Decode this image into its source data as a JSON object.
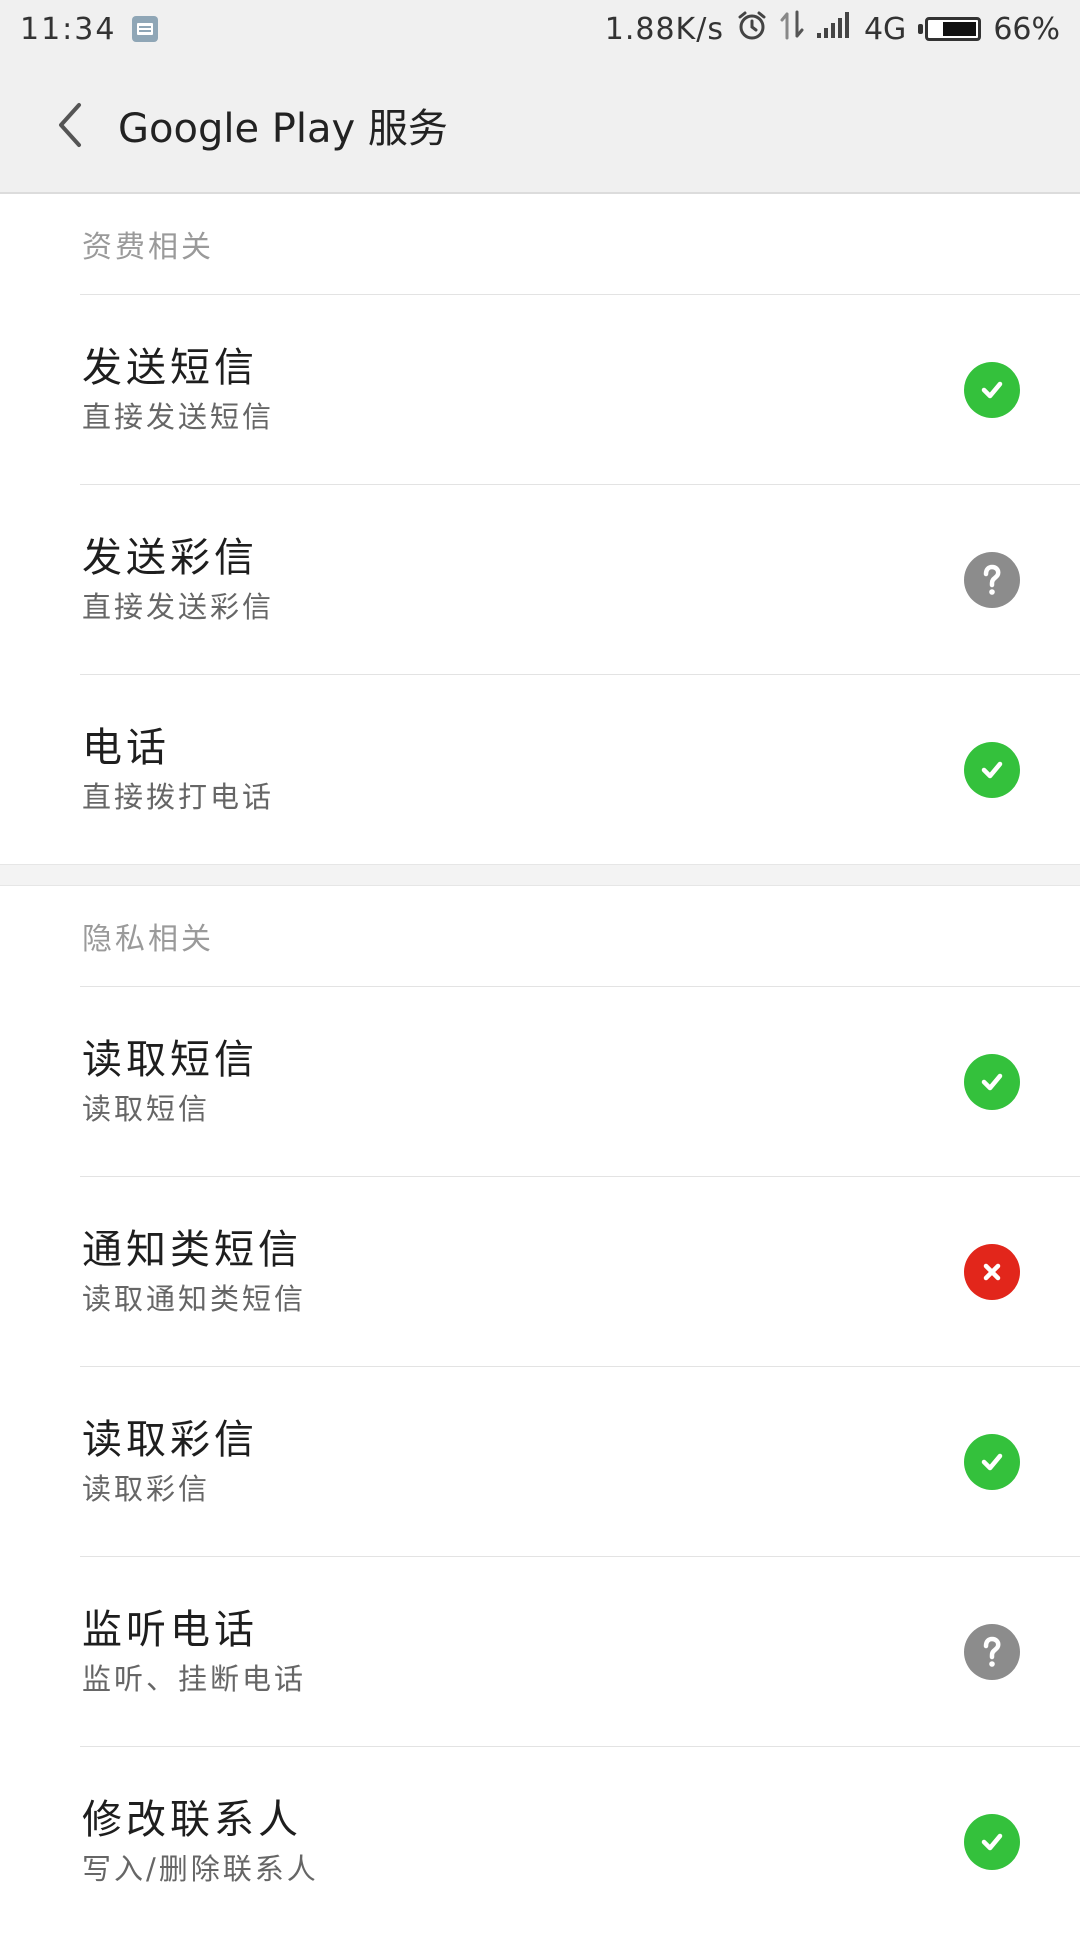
{
  "status_bar": {
    "time": "11:34",
    "net_speed": "1.88K/s",
    "network": "4G",
    "battery": "66%",
    "battery_level": 0.66
  },
  "toolbar": {
    "title": "Google Play 服务",
    "back_icon": "chevron-left-icon"
  },
  "colors": {
    "allowed": "#34c13c",
    "ask": "#8c8c8c",
    "denied": "#e2261b"
  },
  "sections": [
    {
      "header": "资费相关",
      "items": [
        {
          "title": "发送短信",
          "subtitle": "直接发送短信",
          "status": "allowed",
          "icon": "check-icon"
        },
        {
          "title": "发送彩信",
          "subtitle": "直接发送彩信",
          "status": "ask",
          "icon": "question-icon"
        },
        {
          "title": "电话",
          "subtitle": "直接拨打电话",
          "status": "allowed",
          "icon": "check-icon"
        }
      ]
    },
    {
      "header": "隐私相关",
      "items": [
        {
          "title": "读取短信",
          "subtitle": "读取短信",
          "status": "allowed",
          "icon": "check-icon"
        },
        {
          "title": "通知类短信",
          "subtitle": "读取通知类短信",
          "status": "denied",
          "icon": "cross-icon"
        },
        {
          "title": "读取彩信",
          "subtitle": "读取彩信",
          "status": "allowed",
          "icon": "check-icon"
        },
        {
          "title": "监听电话",
          "subtitle": "监听、挂断电话",
          "status": "ask",
          "icon": "question-icon"
        },
        {
          "title": "修改联系人",
          "subtitle": "写入/删除联系人",
          "status": "allowed",
          "icon": "check-icon"
        }
      ]
    }
  ]
}
